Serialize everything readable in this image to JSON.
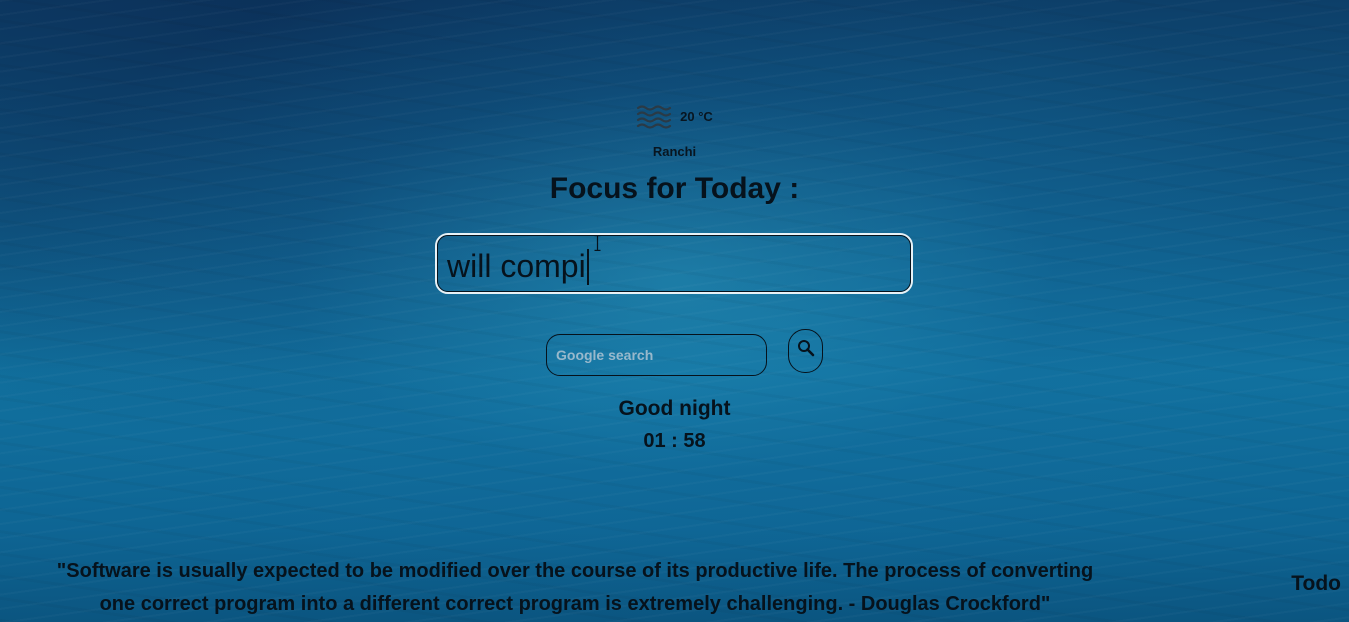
{
  "weather": {
    "icon": "fog-waves-icon",
    "temperature": "20 °C",
    "city": "Ranchi"
  },
  "focus": {
    "title": "Focus for Today :",
    "input_value": "will compi"
  },
  "search": {
    "placeholder": "Google search",
    "button_icon": "search-icon"
  },
  "greeting": "Good night",
  "clock": "01 : 58",
  "quote": {
    "line1": "\"Software is usually expected to be modified over the course of its productive life. The process of converting",
    "line2": "one correct program into a different correct program is extremely challenging. - Douglas Crockford\""
  },
  "todo_label": "Todo"
}
